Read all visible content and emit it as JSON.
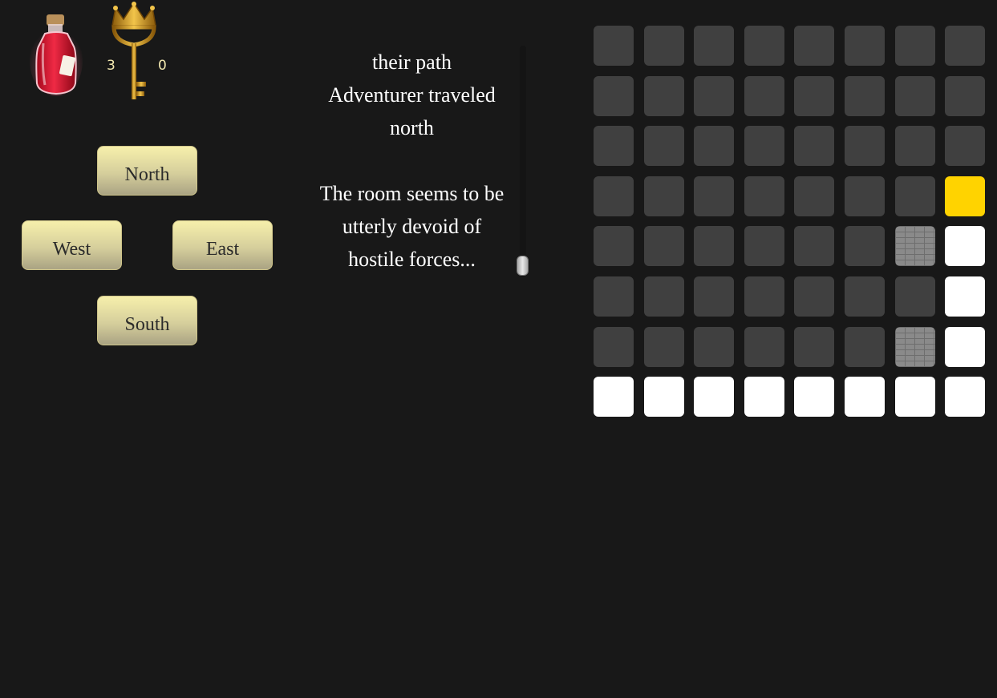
{
  "inventory": {
    "potion_icon": "health-potion-icon",
    "key_icon": "crowned-key-icon",
    "potion_count": "3",
    "key_count": "0"
  },
  "controls": {
    "north": "North",
    "west": "West",
    "east": "East",
    "south": "South"
  },
  "log": {
    "lines": [
      "their path",
      "Adventurer traveled",
      "north",
      "",
      "The room seems to be",
      "utterly devoid of",
      "hostile forces..."
    ]
  },
  "map": {
    "rows": 8,
    "cols": 8,
    "colors": {
      "unexplored": "#404040",
      "visited": "#ffffff",
      "current": "#ffd300",
      "wall": "#8a8a8a"
    },
    "cells": [
      [
        "unexplored",
        "unexplored",
        "unexplored",
        "unexplored",
        "unexplored",
        "unexplored",
        "unexplored",
        "unexplored"
      ],
      [
        "unexplored",
        "unexplored",
        "unexplored",
        "unexplored",
        "unexplored",
        "unexplored",
        "unexplored",
        "unexplored"
      ],
      [
        "unexplored",
        "unexplored",
        "unexplored",
        "unexplored",
        "unexplored",
        "unexplored",
        "unexplored",
        "unexplored"
      ],
      [
        "unexplored",
        "unexplored",
        "unexplored",
        "unexplored",
        "unexplored",
        "unexplored",
        "unexplored",
        "current"
      ],
      [
        "unexplored",
        "unexplored",
        "unexplored",
        "unexplored",
        "unexplored",
        "unexplored",
        "wall",
        "visited"
      ],
      [
        "unexplored",
        "unexplored",
        "unexplored",
        "unexplored",
        "unexplored",
        "unexplored",
        "unexplored",
        "visited"
      ],
      [
        "unexplored",
        "unexplored",
        "unexplored",
        "unexplored",
        "unexplored",
        "unexplored",
        "wall",
        "visited"
      ],
      [
        "visited",
        "visited",
        "visited",
        "visited",
        "visited",
        "visited",
        "visited",
        "visited"
      ]
    ]
  }
}
